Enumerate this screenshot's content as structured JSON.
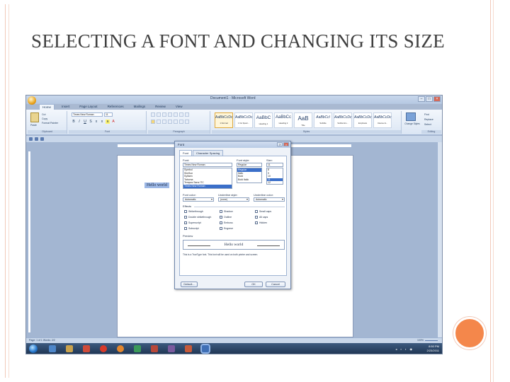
{
  "slide": {
    "title": "SELECTING A FONT AND CHANGING ITS SIZE"
  },
  "word": {
    "window_title": "Document1 - Microsoft Word",
    "tabs": [
      "Home",
      "Insert",
      "Page Layout",
      "References",
      "Mailings",
      "Review",
      "View"
    ],
    "ribbon": {
      "paste_label": "Paste",
      "cut": "Cut",
      "copy": "Copy",
      "format_painter": "Format Painter",
      "clipboard_group": "Clipboard",
      "font_name": "Times New Roman",
      "font_size": "11",
      "font_group": "Font",
      "paragraph_group": "Paragraph",
      "styles_group": "Styles",
      "editing_group": "Editing",
      "styles": [
        {
          "sample": "AaBbCcDc",
          "name": "1 Normal"
        },
        {
          "sample": "AaBbCcDc",
          "name": "1 No Spaci..."
        },
        {
          "sample": "AaBbC",
          "name": "Heading 1"
        },
        {
          "sample": "AaBbCc",
          "name": "Heading 2"
        },
        {
          "sample": "AaB",
          "name": "Title"
        },
        {
          "sample": "AaBbCcl",
          "name": "Subtitle"
        },
        {
          "sample": "AaBbCcDc",
          "name": "Subtle Em..."
        },
        {
          "sample": "AaBbCcDc",
          "name": "Emphasis"
        },
        {
          "sample": "AaBbCcDc",
          "name": "Intense E..."
        }
      ],
      "change_styles": "Change Styles",
      "find": "Find",
      "replace": "Replace",
      "select": "Select"
    },
    "document_text": "Hello world",
    "status": {
      "left": "Page: 1 of 1    Words: 2/2",
      "right": "100%"
    },
    "taskbar": {
      "time": "8:50 PM",
      "date": "2/23/2011"
    }
  },
  "font_dialog": {
    "title": "Font",
    "tabs": [
      "Font",
      "Character Spacing"
    ],
    "font_label": "Font:",
    "font_value": "Times New Roman",
    "font_list": [
      "Symbol",
      "SimSun",
      "Sylfaen",
      "Tahoma",
      "Tempus Sans ITC",
      "Times New Roman"
    ],
    "font_selected_index": 5,
    "style_label": "Font style:",
    "style_value": "Regular",
    "style_list": [
      "Regular",
      "Italic",
      "Bold",
      "Bold Italic"
    ],
    "style_selected_index": 0,
    "size_label": "Size:",
    "size_value": "11",
    "size_list": [
      "8",
      "9",
      "10",
      "11",
      "12"
    ],
    "size_selected_index": 3,
    "font_color_label": "Font color:",
    "font_color_value": "Automatic",
    "underline_style_label": "Underline style:",
    "underline_style_value": "(none)",
    "underline_color_label": "Underline color:",
    "underline_color_value": "Automatic",
    "effects_label": "Effects",
    "effects": [
      [
        "Strikethrough",
        "Shadow",
        "Small caps"
      ],
      [
        "Double strikethrough",
        "Outline",
        "All caps"
      ],
      [
        "Superscript",
        "Emboss",
        "Hidden"
      ],
      [
        "Subscript",
        "Engrave",
        ""
      ]
    ],
    "preview_label": "Preview",
    "preview_text": "Hello world",
    "note": "This is a TrueType font. This font will be used on both printer and screen.",
    "default_button": "Default...",
    "ok_button": "OK",
    "cancel_button": "Cancel"
  }
}
